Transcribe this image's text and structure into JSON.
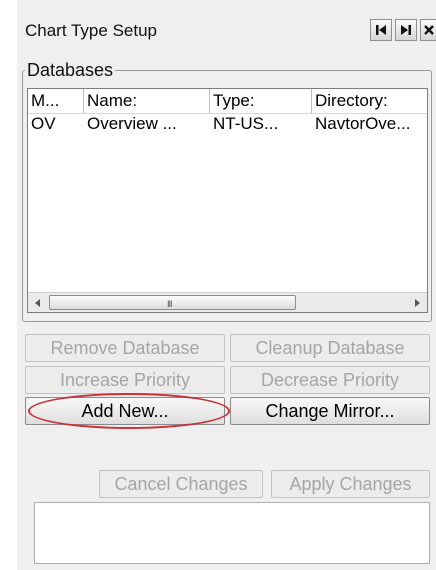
{
  "window": {
    "title": "Chart Type Setup"
  },
  "nav": {
    "first_icon": "skip-to-start-icon",
    "last_icon": "skip-to-end-icon",
    "close_icon": "close-icon"
  },
  "databases": {
    "legend": "Databases",
    "columns": [
      "M...",
      "Name:",
      "Type:",
      "Directory:"
    ],
    "rows": [
      [
        "OV",
        "Overview ...",
        "NT-US...",
        "NavtorOve..."
      ]
    ],
    "scroll_grip": "III"
  },
  "buttons": {
    "remove_database": "Remove Database",
    "cleanup_database": "Cleanup Database",
    "increase_priority": "Increase Priority",
    "decrease_priority": "Decrease Priority",
    "add_new": "Add New...",
    "change_mirror": "Change Mirror...",
    "cancel_changes": "Cancel Changes",
    "apply_changes": "Apply Changes"
  },
  "colors": {
    "highlight": "#c8303a",
    "panel_bg": "#efefef",
    "disabled_text": "#a5a5a5"
  }
}
